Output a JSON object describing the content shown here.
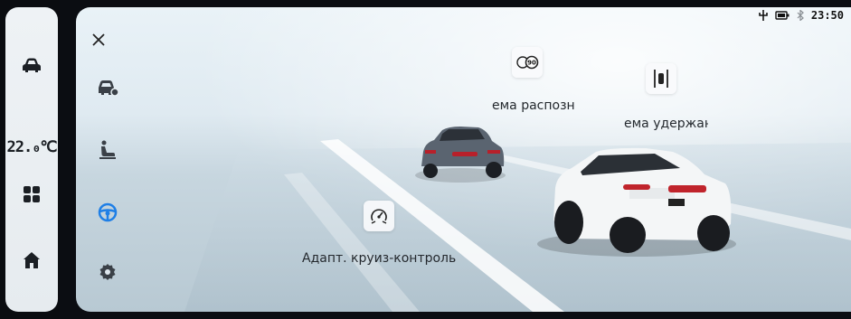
{
  "rail": {
    "temperature": "22.₀℃",
    "items": [
      {
        "icon": "car-icon"
      },
      {
        "icon": "apps-grid-icon"
      },
      {
        "icon": "home-icon"
      }
    ]
  },
  "status_bar": {
    "icons": [
      "usb-icon",
      "battery-icon",
      "bluetooth-icon"
    ],
    "time": "23:50"
  },
  "side_menu": {
    "close_icon": "close-icon",
    "items": [
      {
        "icon": "car-settings-icon",
        "active": false
      },
      {
        "icon": "seat-icon",
        "active": false
      },
      {
        "icon": "steering-wheel-icon",
        "active": true
      },
      {
        "icon": "gear-icon",
        "active": false
      }
    ]
  },
  "features": [
    {
      "icon": "speed-limit-recognition-icon",
      "label": "ема распозн",
      "badge": "90"
    },
    {
      "icon": "lane-keeping-icon",
      "label": "ема удержан"
    },
    {
      "icon": "adaptive-cruise-icon",
      "label": "Адапт. круиз-контроль"
    }
  ],
  "colors": {
    "accent": "#1f7fe6",
    "icon_dark": "#3a4047"
  }
}
